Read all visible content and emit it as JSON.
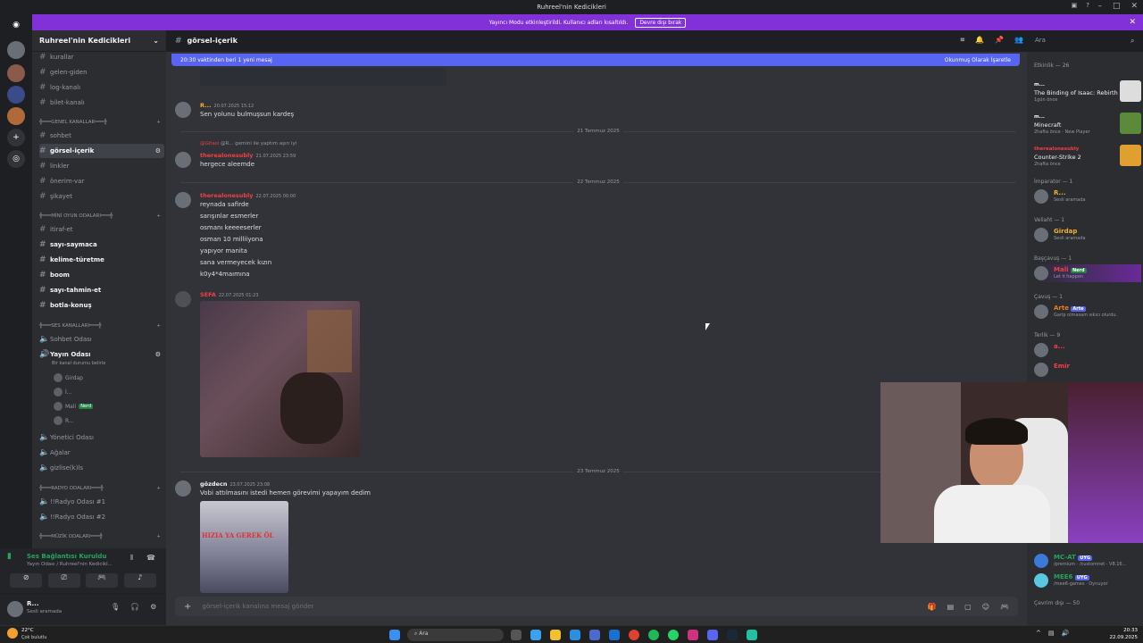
{
  "window": {
    "title": "Ruhreel'nin Kedicikleri"
  },
  "banner": {
    "text": "Yayıncı Modu etkinleştirildi. Kullanıcı adları kısaltıldı.",
    "button": "Devre dışı bırak"
  },
  "server": {
    "name": "Ruhreel'nin Kedicikleri"
  },
  "channels": {
    "c1": "kurallar",
    "c2": "gelen-giden",
    "c3": "log-kanalı",
    "c4": "bilet-kanalı",
    "cat1": "╬═══GENEL KANALLAR═══╬",
    "c5": "sohbet",
    "c6": "görsel-içerik",
    "c7": "linkler",
    "c8": "önerim-var",
    "c9": "şikayet",
    "cat2": "╬═══MİNİ OYUN ODALARI═══╬",
    "c10": "itiraf-et",
    "c11": "sayı-saymaca",
    "c12": "kelime-türetme",
    "c13": "boom",
    "c14": "sayı-tahmin-et",
    "c15": "botla-konuş",
    "cat3": "╬═══SES KANALLARI═══╬",
    "v1": "Sohbet Odası",
    "v2": "Yayın Odası",
    "v2status": "Bir kanal durumu belirle",
    "vu1": "Girdap",
    "vu2": "İ...",
    "vu3": "Mali",
    "vu3badge": "Nerd",
    "vu4": "R...",
    "v3": "Yönetici Odası",
    "v4": "Ağalar",
    "v5": "gizlise(k)ls",
    "cat4": "╬═══RADYO ODALARI═══╬",
    "v6": "!!Radyo Odası #1",
    "v7": "!!Radyo Odası #2",
    "cat5": "╬═══MÜZİK ODALARI═══╬"
  },
  "voice": {
    "status": "Ses Bağlantısı Kuruldu",
    "channel": "Yayın Odası / Ruhreel'nin Kedicikl..."
  },
  "user": {
    "name": "R...",
    "status": "Sesli aramada"
  },
  "topbar": {
    "channel": "görsel-içerik"
  },
  "search": {
    "placeholder": "Ara"
  },
  "newbar": {
    "left": "20:30 vaktinden beri 1 yeni mesaj",
    "right": "Okunmuş Olarak İşaretle"
  },
  "messages": {
    "m1": {
      "name": "R...",
      "time": "20.07.2025 15:12",
      "text": "Sen yolunu bulmuşsun kardeş"
    },
    "d1": "21 Temmuz 2025",
    "m2": {
      "reply": "@R... gemini ile yaptım aşırı iyi",
      "replyname": "@Gitasi",
      "name": "therealonesubly",
      "time": "21.07.2025 23:59",
      "text": "hergece aleemde"
    },
    "d2": "22 Temmuz 2025",
    "m3": {
      "name": "therealonesubly",
      "time": "22.07.2025 00:00",
      "lines": [
        "reynada safirde",
        "sarışınlar esmerler",
        "osmanı keeeeserler",
        "osman 10 milliiyona",
        "yapıyor manita",
        "sana vermeyecek kızın",
        "k0y4*4maımına"
      ]
    },
    "m4": {
      "name": "SEFA",
      "time": "22.07.2025 01:23"
    },
    "d3": "23 Temmuz 2025",
    "m5": {
      "name": "gözdecn",
      "time": "23.07.2025 23:08",
      "text": "Vobi attılmasını istedi hemen görevimi yapayım dedim",
      "meme": "HIZIA YA GEREK ÖL"
    }
  },
  "composer": {
    "placeholder": "görsel-içerik kanalına mesaj gönder"
  },
  "members": {
    "activity_header": "Etkinlik — 26",
    "a1": {
      "user": "m...",
      "title": "The Binding of Isaac: Rebirth",
      "sub": "1gün önce"
    },
    "a2": {
      "user": "m...",
      "title": "Minecraft",
      "sub": "2hafta önce · New Player"
    },
    "a3": {
      "user": "therealonesubly",
      "title": "Counter-Strike 2",
      "sub": "2hafta önce"
    },
    "s1": "İmparator — 1",
    "u1": {
      "name": "R...",
      "status": "Sesli aramada"
    },
    "s2": "Veliaht — 1",
    "u2": {
      "name": "Girdap",
      "status": "Sesli aramada"
    },
    "s3": "Başçavuş — 1",
    "u3": {
      "name": "Mali",
      "badge": "Nerd",
      "status": "Let it happen"
    },
    "s4": "Çavuş — 1",
    "u4": {
      "name": "Arte",
      "badge": "Arte",
      "status": "Garip olmasam sıkıcı olurdu."
    },
    "s5": "Terlik — 9",
    "u5": {
      "name": "a...",
      "status": ""
    },
    "u6": {
      "name": "Emir",
      "status": ""
    },
    "u7": {
      "name": "MC-AT",
      "badge": "UYG",
      "status": "/premium · /customnet · V8.16..."
    },
    "u8": {
      "name": "MEE6",
      "badge": "UYG",
      "status": "/mee6-games · Oynuyor"
    },
    "offline": "Çevrim dışı — 50"
  },
  "taskbar": {
    "weather_temp": "22°C",
    "weather_desc": "Çok bulutlu",
    "search": "Ara",
    "time": "20:33",
    "date": "22.09.2025"
  },
  "colors": {
    "accent": "#5865f2",
    "banner": "#8230d8",
    "red_user": "#f23f43",
    "gold_user": "#f0b232"
  }
}
